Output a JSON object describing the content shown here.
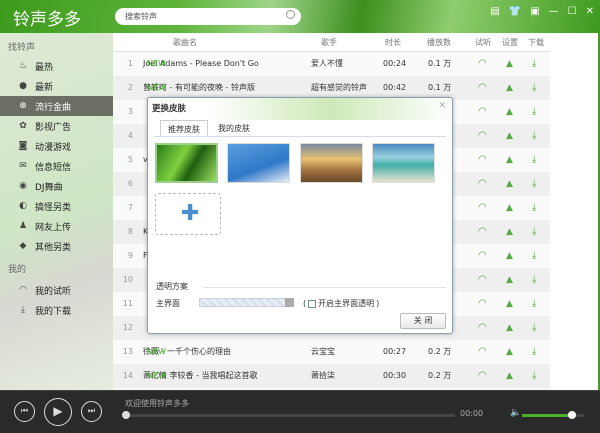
{
  "app": {
    "title": "铃声多多",
    "search_placeholder": "搜索铃声"
  },
  "window_buttons": [
    "▤",
    "👕",
    "▣",
    "—",
    "☐",
    "✕"
  ],
  "sidebar": {
    "section_find": "找铃声",
    "items": [
      {
        "label": "最热",
        "icon": "flame-icon",
        "g": "♨"
      },
      {
        "label": "最新",
        "icon": "new-icon",
        "g": "●"
      },
      {
        "label": "流行金曲",
        "icon": "globe-icon",
        "g": "⊕"
      },
      {
        "label": "影视广告",
        "icon": "film-icon",
        "g": "✿"
      },
      {
        "label": "动漫游戏",
        "icon": "gamepad-icon",
        "g": "◙"
      },
      {
        "label": "信息短信",
        "icon": "envelope-icon",
        "g": "✉"
      },
      {
        "label": "DJ舞曲",
        "icon": "disc-icon",
        "g": "◉"
      },
      {
        "label": "搞怪另类",
        "icon": "pacman-icon",
        "g": "◐"
      },
      {
        "label": "网友上传",
        "icon": "user-icon",
        "g": "♟"
      },
      {
        "label": "其他另类",
        "icon": "tag-icon",
        "g": "◆"
      }
    ],
    "selected": 2,
    "section_mine": "我的",
    "mine": [
      {
        "label": "我的试听",
        "icon": "headphones-icon",
        "g": "◠"
      },
      {
        "label": "我的下载",
        "icon": "download-icon",
        "g": "⤓"
      }
    ]
  },
  "table": {
    "headers": {
      "title": "歌曲名",
      "singer": "歌手",
      "duration": "时长",
      "plays": "播放数",
      "listen": "试听",
      "set": "设置",
      "download": "下载"
    },
    "new_badge": "NEW",
    "rows": [
      {
        "n": "1",
        "title": "Joel Adams - Please Don't Go",
        "singer": "爱人不懂",
        "dur": "00:24",
        "plays": "0.1 万",
        "new": true
      },
      {
        "n": "2",
        "title": "曾轶可 - 有可能的夜晚 - 铃声版",
        "singer": "超有感觉的铃声",
        "dur": "00:42",
        "plays": "0.1 万",
        "new": true
      },
      {
        "n": "3",
        "title": ""
      },
      {
        "n": "4",
        "title": ""
      },
      {
        "n": "5",
        "title": "v"
      },
      {
        "n": "6",
        "title": ""
      },
      {
        "n": "7",
        "title": ""
      },
      {
        "n": "8",
        "title": "K"
      },
      {
        "n": "9",
        "title": "F"
      },
      {
        "n": "10",
        "title": ""
      },
      {
        "n": "11",
        "title": ""
      },
      {
        "n": "12",
        "title": ""
      },
      {
        "n": "13",
        "title": "徐薇 - 一千个伤心的理由",
        "singer": "云宝宝",
        "dur": "00:27",
        "plays": "0.2 万",
        "new": true
      },
      {
        "n": "14",
        "title": "萧亿情 李较香 - 当我唱起这首歌",
        "singer": "萧拾柒",
        "dur": "00:30",
        "plays": "0.2 万",
        "new": true
      }
    ]
  },
  "dialog": {
    "title": "更换皮肤",
    "close": "✕",
    "tabs": [
      "推荐皮肤",
      "我的皮肤"
    ],
    "active_tab": 0,
    "skins": [
      "green-leaf",
      "blossom-sky",
      "sunset-field",
      "beach"
    ],
    "transparency_label": "透明方案",
    "main_label": "主界面",
    "checkbox_label": "开启主界面透明",
    "checkbox_checked": false,
    "close_button": "关 闭",
    "transparency_value": 1.0
  },
  "player": {
    "welcome": "欢迎使用铃声多多",
    "time": "00:00",
    "progress": 0,
    "volume": 0.8
  }
}
